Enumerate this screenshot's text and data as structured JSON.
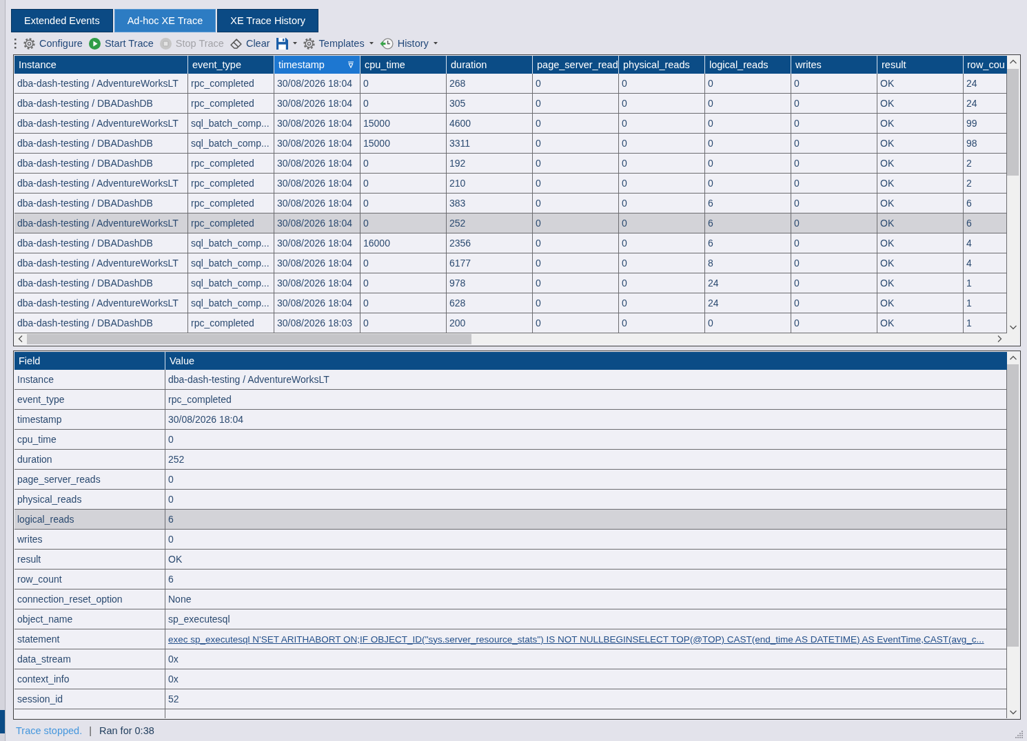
{
  "tabs": [
    {
      "label": "Extended Events",
      "selected": false
    },
    {
      "label": "Ad-hoc XE Trace",
      "selected": true
    },
    {
      "label": "XE Trace History",
      "selected": false
    }
  ],
  "toolbar": [
    {
      "label": "Configure",
      "disabled": false,
      "dropdown": false
    },
    {
      "label": "Start Trace",
      "disabled": false,
      "dropdown": false
    },
    {
      "label": "Stop Trace",
      "disabled": true,
      "dropdown": false
    },
    {
      "label": "Clear",
      "disabled": false,
      "dropdown": false
    },
    {
      "disabled": false,
      "dropdown": true
    },
    {
      "label": "Templates",
      "disabled": false,
      "dropdown": true
    },
    {
      "label": "History",
      "disabled": false,
      "dropdown": true
    }
  ],
  "events_grid": {
    "columns": [
      {
        "label": "Instance",
        "filtered": false
      },
      {
        "label": "event_type",
        "filtered": false
      },
      {
        "label": "timestamp",
        "filtered": true
      },
      {
        "label": "cpu_time",
        "filtered": false
      },
      {
        "label": "duration",
        "filtered": false
      },
      {
        "label": "page_server_read",
        "filtered": false
      },
      {
        "label": "physical_reads",
        "filtered": false
      },
      {
        "label": "logical_reads",
        "filtered": false
      },
      {
        "label": "writes",
        "filtered": false
      },
      {
        "label": "result",
        "filtered": false
      },
      {
        "label": "row_cou",
        "filtered": false
      }
    ],
    "rows": [
      {
        "selected": false,
        "cells": [
          "dba-dash-testing / AdventureWorksLT",
          "rpc_completed",
          "30/08/2026 18:04",
          "0",
          "268",
          "0",
          "0",
          "0",
          "0",
          "OK",
          "24"
        ]
      },
      {
        "selected": false,
        "cells": [
          "dba-dash-testing / DBADashDB",
          "rpc_completed",
          "30/08/2026 18:04",
          "0",
          "305",
          "0",
          "0",
          "0",
          "0",
          "OK",
          "24"
        ]
      },
      {
        "selected": false,
        "cells": [
          "dba-dash-testing / AdventureWorksLT",
          "sql_batch_comp...",
          "30/08/2026 18:04",
          "15000",
          "4600",
          "0",
          "0",
          "0",
          "0",
          "OK",
          "99"
        ]
      },
      {
        "selected": false,
        "cells": [
          "dba-dash-testing / DBADashDB",
          "sql_batch_comp...",
          "30/08/2026 18:04",
          "15000",
          "3311",
          "0",
          "0",
          "0",
          "0",
          "OK",
          "98"
        ]
      },
      {
        "selected": false,
        "cells": [
          "dba-dash-testing / DBADashDB",
          "rpc_completed",
          "30/08/2026 18:04",
          "0",
          "192",
          "0",
          "0",
          "0",
          "0",
          "OK",
          "2"
        ]
      },
      {
        "selected": false,
        "cells": [
          "dba-dash-testing / AdventureWorksLT",
          "rpc_completed",
          "30/08/2026 18:04",
          "0",
          "210",
          "0",
          "0",
          "0",
          "0",
          "OK",
          "2"
        ]
      },
      {
        "selected": false,
        "cells": [
          "dba-dash-testing / DBADashDB",
          "rpc_completed",
          "30/08/2026 18:04",
          "0",
          "383",
          "0",
          "0",
          "6",
          "0",
          "OK",
          "6"
        ]
      },
      {
        "selected": true,
        "cells": [
          "dba-dash-testing / AdventureWorksLT",
          "rpc_completed",
          "30/08/2026 18:04",
          "0",
          "252",
          "0",
          "0",
          "6",
          "0",
          "OK",
          "6"
        ]
      },
      {
        "selected": false,
        "cells": [
          "dba-dash-testing / DBADashDB",
          "sql_batch_comp...",
          "30/08/2026 18:04",
          "16000",
          "2356",
          "0",
          "0",
          "6",
          "0",
          "OK",
          "4"
        ]
      },
      {
        "selected": false,
        "cells": [
          "dba-dash-testing / AdventureWorksLT",
          "sql_batch_comp...",
          "30/08/2026 18:04",
          "0",
          "6177",
          "0",
          "0",
          "8",
          "0",
          "OK",
          "4"
        ]
      },
      {
        "selected": false,
        "cells": [
          "dba-dash-testing / DBADashDB",
          "sql_batch_comp...",
          "30/08/2026 18:04",
          "0",
          "978",
          "0",
          "0",
          "24",
          "0",
          "OK",
          "1"
        ]
      },
      {
        "selected": false,
        "cells": [
          "dba-dash-testing / AdventureWorksLT",
          "sql_batch_comp...",
          "30/08/2026 18:04",
          "0",
          "628",
          "0",
          "0",
          "24",
          "0",
          "OK",
          "1"
        ]
      },
      {
        "selected": false,
        "cells": [
          "dba-dash-testing / DBADashDB",
          "rpc_completed",
          "30/08/2026 18:03",
          "0",
          "200",
          "0",
          "0",
          "0",
          "0",
          "OK",
          "1"
        ]
      }
    ]
  },
  "details_grid": {
    "columns": [
      "Field",
      "Value"
    ],
    "rows": [
      {
        "field": "Instance",
        "value": "dba-dash-testing / AdventureWorksLT",
        "kind": "text",
        "selected": false
      },
      {
        "field": "event_type",
        "value": "rpc_completed",
        "kind": "text",
        "selected": false
      },
      {
        "field": "timestamp",
        "value": "30/08/2026 18:04",
        "kind": "text",
        "selected": false
      },
      {
        "field": "cpu_time",
        "value": "0",
        "kind": "text",
        "selected": false
      },
      {
        "field": "duration",
        "value": "252",
        "kind": "text",
        "selected": false
      },
      {
        "field": "page_server_reads",
        "value": "0",
        "kind": "text",
        "selected": false
      },
      {
        "field": "physical_reads",
        "value": "0",
        "kind": "text",
        "selected": false
      },
      {
        "field": "logical_reads",
        "value": "6",
        "kind": "text",
        "selected": true
      },
      {
        "field": "writes",
        "value": "0",
        "kind": "text",
        "selected": false
      },
      {
        "field": "result",
        "value": "OK",
        "kind": "text",
        "selected": false
      },
      {
        "field": "row_count",
        "value": "6",
        "kind": "text",
        "selected": false
      },
      {
        "field": "connection_reset_option",
        "value": "None",
        "kind": "text",
        "selected": false
      },
      {
        "field": "object_name",
        "value": "sp_executesql",
        "kind": "text",
        "selected": false
      },
      {
        "field": "statement",
        "value": "exec sp_executesql N'SET ARITHABORT ON;IF OBJECT_ID(''sys.server_resource_stats'') IS NOT NULLBEGINSELECT TOP(@TOP) CAST(end_time AS DATETIME) AS EventTime,CAST(avg_c...",
        "kind": "link",
        "selected": false
      },
      {
        "field": "data_stream",
        "value": "0x",
        "kind": "text",
        "selected": false
      },
      {
        "field": "context_info",
        "value": "0x",
        "kind": "text",
        "selected": false
      },
      {
        "field": "session_id",
        "value": "52",
        "kind": "text",
        "selected": false
      }
    ]
  },
  "status_bar": {
    "status": "Trace stopped.",
    "separator": "|",
    "elapsed": "Ran for 0:38"
  }
}
